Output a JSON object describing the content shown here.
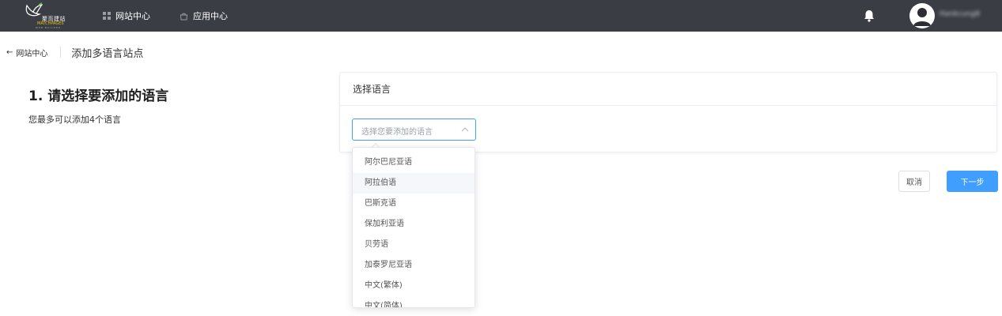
{
  "topbar": {
    "logo": {
      "cn": "聚页建站",
      "en": "MATCHPAGES",
      "sub": "WEB BUILDER"
    },
    "nav": [
      {
        "label": "网站中心",
        "icon": "grid-icon"
      },
      {
        "label": "应用中心",
        "icon": "bag-icon"
      }
    ],
    "notification_icon": "bell-icon",
    "avatar_icon": "user-icon",
    "username": "Hankcung8"
  },
  "breadcrumb": {
    "back_icon": "arrow-left-icon",
    "back_label": "网站中心",
    "title": "添加多语言站点"
  },
  "step": {
    "title": "1. 请选择要添加的语言",
    "desc": "您最多可以添加4个语言"
  },
  "card": {
    "header": "选择语言",
    "select": {
      "placeholder": "选择您要添加的语言",
      "arrow_icon": "chevron-up-icon",
      "open": true
    }
  },
  "dropdown": {
    "options": [
      "阿尔巴尼亚语",
      "阿拉伯语",
      "巴斯克语",
      "保加利亚语",
      "贝劳语",
      "加泰罗尼亚语",
      "中文(繁体)",
      "中文(简体)"
    ],
    "hovered": "阿拉伯语"
  },
  "buttons": {
    "cancel": "取消",
    "next": "下一步"
  },
  "colors": {
    "topbar": "#3a3d44",
    "primary": "#409eff",
    "hover": "#f5f7fa",
    "logo_accent": "#f2c200"
  }
}
